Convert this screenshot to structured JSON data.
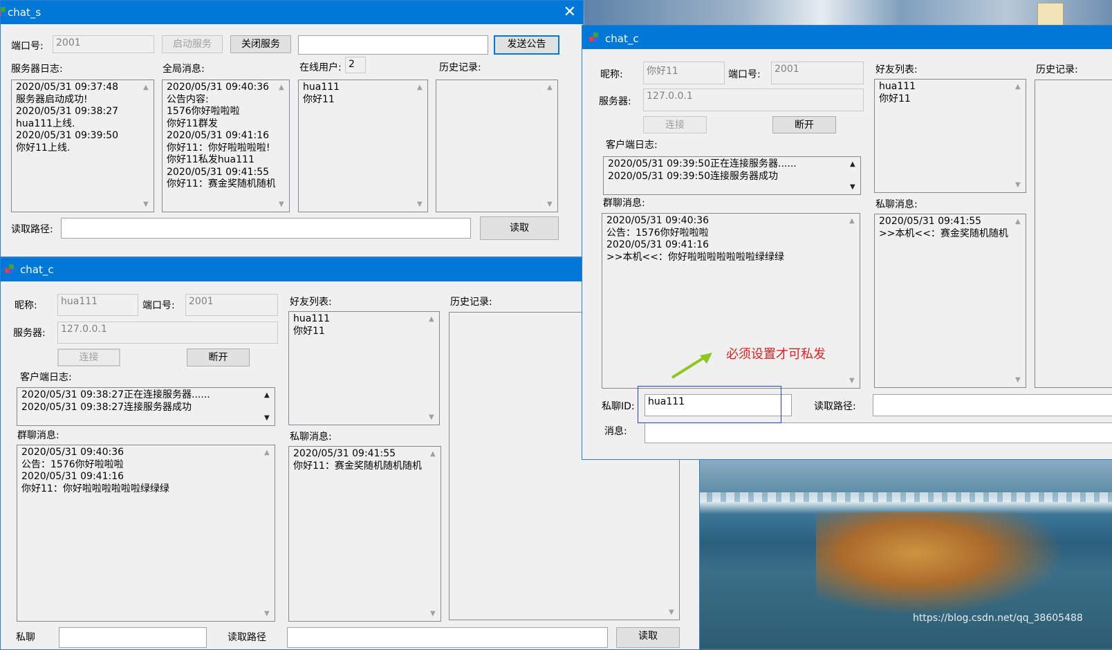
{
  "server_window": {
    "title": "chat_s",
    "port_label": "端口号:",
    "port_value": "2001",
    "start_btn": "启动服务",
    "stop_btn": "关闭服务",
    "announce_input": "",
    "announce_btn": "发送公告",
    "server_log_label": "服务器日志:",
    "global_msg_label": "全局消息:",
    "online_label": "在线用户:",
    "online_count": "2",
    "history_label": "历史记录:",
    "server_log": [
      "2020/05/31 09:37:48",
      "服务器启动成功!",
      "2020/05/31 09:38:27",
      "hua111上线.",
      "2020/05/31 09:39:50",
      "你好11上线."
    ],
    "global_msgs": [
      "2020/05/31 09:40:36",
      "公告内容:",
      "1576你好啦啦啦",
      "你好11群发",
      "2020/05/31 09:41:16",
      "你好11：你好啦啦啦啦!",
      "你好11私发hua111",
      "2020/05/31 09:41:55",
      "你好11：赛金奖随机随机"
    ],
    "online_users": [
      "hua111",
      "你好11"
    ],
    "read_path_label": "读取路径:",
    "read_path_value": "",
    "read_btn": "读取"
  },
  "client_a": {
    "title": "chat_c",
    "nick_label": "昵称:",
    "nick_value": "hua111",
    "port_label": "端口号:",
    "port_value": "2001",
    "server_label": "服务器:",
    "server_value": "127.0.0.1",
    "connect_btn": "连接",
    "disconnect_btn": "断开",
    "client_log_label": "客户端日志:",
    "client_log": [
      "2020/05/31 09:38:27正在连接服务器......",
      "2020/05/31 09:38:27连接服务器成功"
    ],
    "group_label": "群聊消息:",
    "group_msgs": [
      "2020/05/31 09:40:36",
      "公告：1576你好啦啦啦",
      "2020/05/31 09:41:16",
      "你好11：你好啦啦啦啦啦啦绿绿绿"
    ],
    "friends_label": "好友列表:",
    "friends": [
      "hua111",
      "你好11"
    ],
    "private_label": "私聊消息:",
    "private_msgs": [
      "2020/05/31 09:41:55",
      "你好11：赛金奖随机随机随机"
    ],
    "history_label": "历史记录:",
    "bottom_left_label": "私聊",
    "bottom_mid_label": "读取路径",
    "bottom_btn": "读取"
  },
  "client_b": {
    "title": "chat_c",
    "nick_label": "昵称:",
    "nick_value": "你好11",
    "port_label": "端口号:",
    "port_value": "2001",
    "server_label": "服务器:",
    "server_value": "127.0.0.1",
    "connect_btn": "连接",
    "disconnect_btn": "断开",
    "client_log_label": "客户端日志:",
    "client_log": [
      "2020/05/31 09:39:50正在连接服务器......",
      "2020/05/31 09:39:50连接服务器成功"
    ],
    "group_label": "群聊消息:",
    "group_msgs": [
      "2020/05/31 09:40:36",
      "公告：1576你好啦啦啦",
      "2020/05/31 09:41:16",
      ">>本机<<：你好啦啦啦啦啦啦啦绿绿绿"
    ],
    "friends_label": "好友列表:",
    "friends": [
      "hua111",
      "你好11"
    ],
    "private_label": "私聊消息:",
    "private_msgs": [
      "2020/05/31 09:41:55",
      ">>本机<<：赛金奖随机随机"
    ],
    "history_label": "历史记录:",
    "private_id_label": "私聊ID:",
    "private_id_value": "hua111",
    "read_path_label": "读取路径:",
    "message_label": "消息:",
    "message_value": ""
  },
  "annotation": "必须设置才可私发",
  "watermark": "https://blog.csdn.net/qq_38605488",
  "colors": {
    "titlebar": "#0078d7",
    "annotation": "#e02020",
    "arrow": "#8cc820"
  }
}
